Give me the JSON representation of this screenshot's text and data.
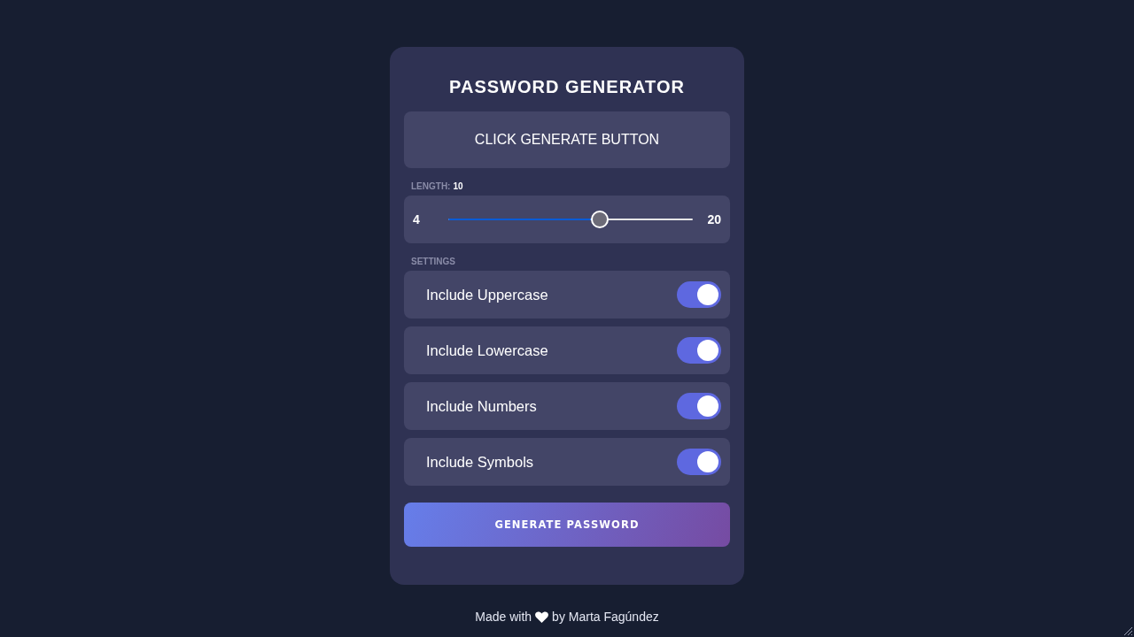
{
  "title": "PASSWORD GENERATOR",
  "result": {
    "text": "CLICK GENERATE BUTTON"
  },
  "length": {
    "label": "LENGTH:",
    "value": "10",
    "min": "4",
    "max": "20",
    "level": 0.62
  },
  "settings": {
    "label": "SETTINGS",
    "options": [
      {
        "label": "Include Uppercase",
        "on": true
      },
      {
        "label": "Include Lowercase",
        "on": true
      },
      {
        "label": "Include Numbers",
        "on": true
      },
      {
        "label": "Include Symbols",
        "on": true
      }
    ]
  },
  "generate_button": {
    "label": "GENERATE PASSWORD"
  },
  "footer": {
    "text_before": "Made with",
    "text_after": "by Marta Fagúndez"
  }
}
